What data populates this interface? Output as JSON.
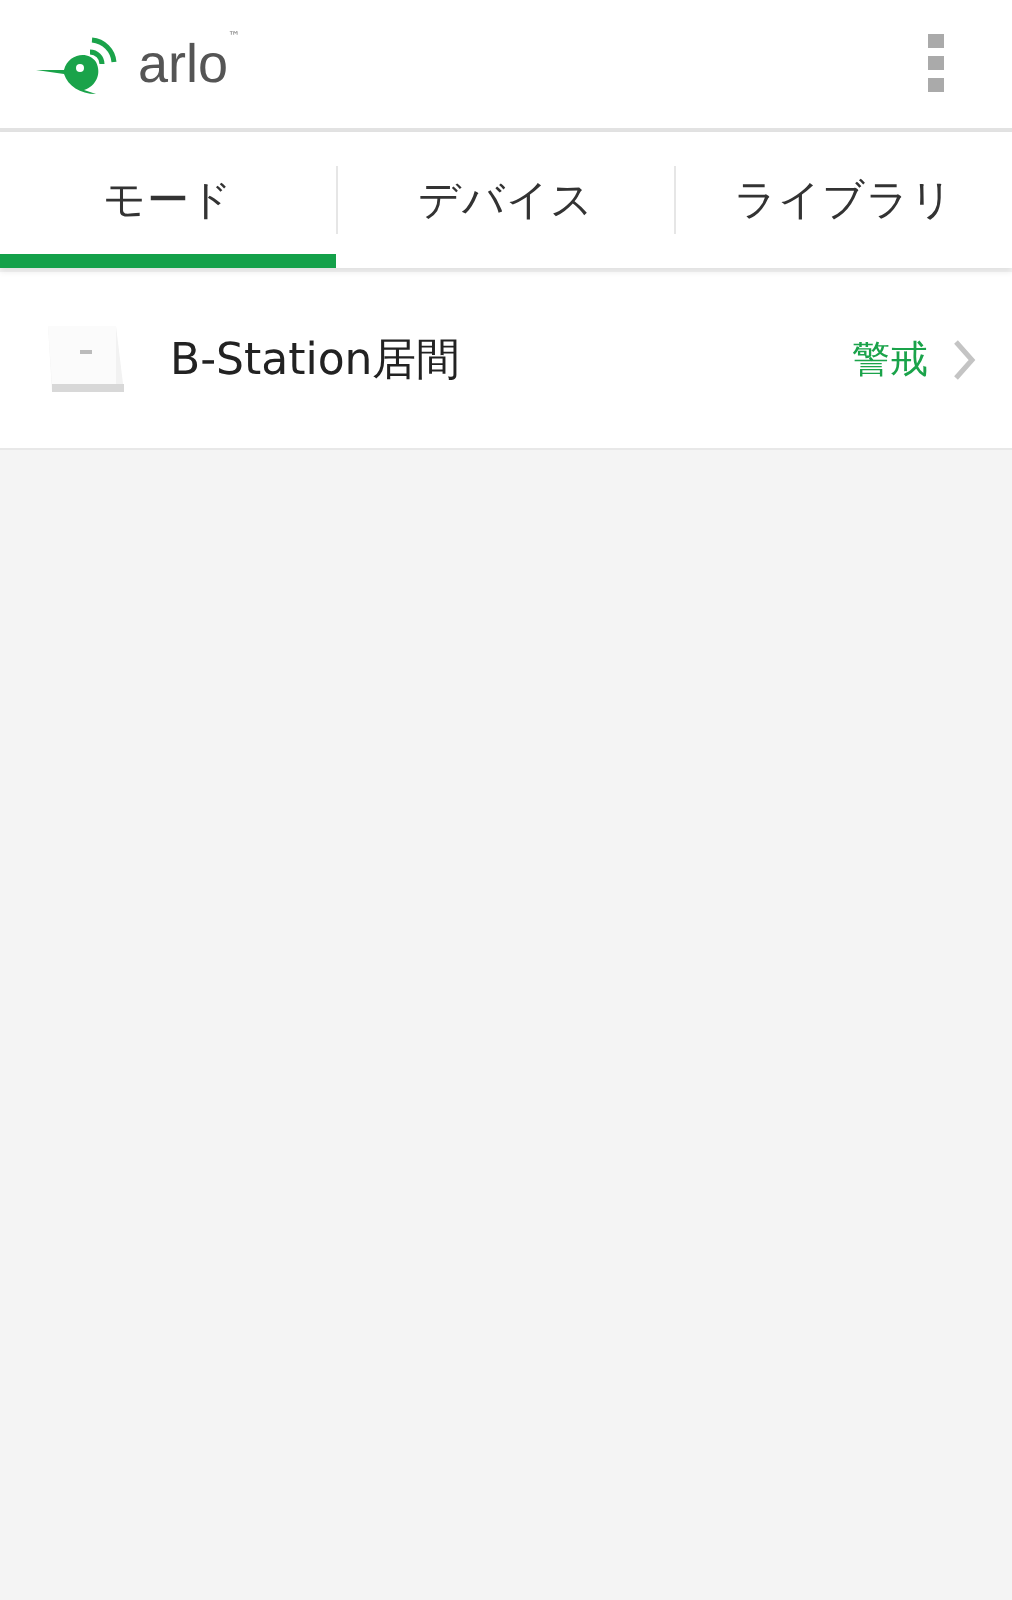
{
  "header": {
    "logo": "arlo",
    "trademark": "™"
  },
  "tabs": [
    {
      "label": "モード",
      "selected": true
    },
    {
      "label": "デバイス",
      "selected": false
    },
    {
      "label": "ライブラリ",
      "selected": false
    }
  ],
  "devices": [
    {
      "name": "B-Station居間",
      "mode": "警戒"
    }
  ]
}
